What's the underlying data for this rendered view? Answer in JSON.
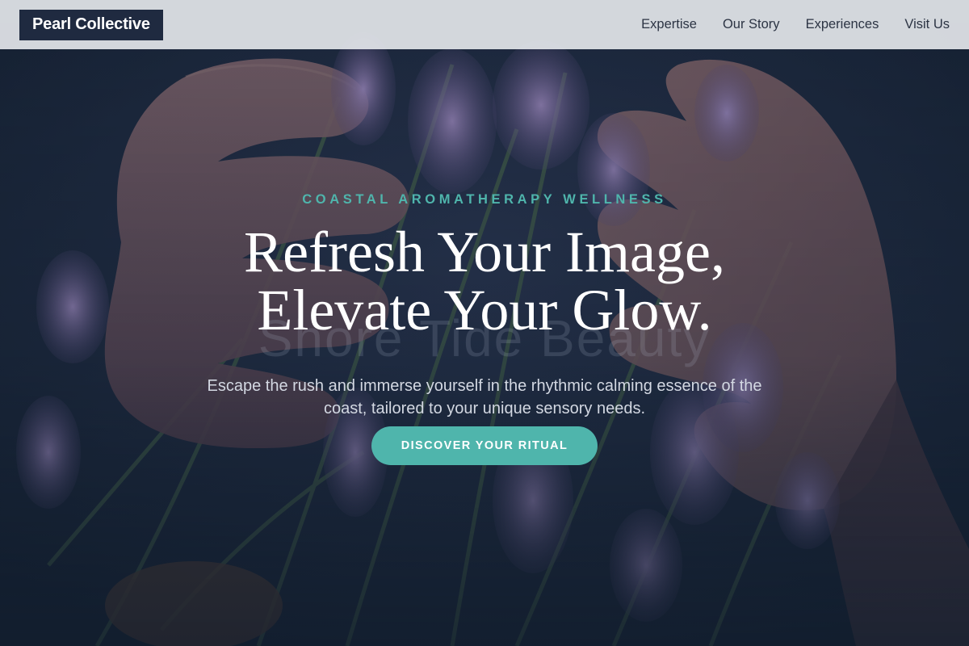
{
  "brand": {
    "name": "Pearl Collective"
  },
  "nav": {
    "items": [
      {
        "label": "Expertise"
      },
      {
        "label": "Our Story"
      },
      {
        "label": "Experiences"
      },
      {
        "label": "Visit Us"
      }
    ]
  },
  "hero": {
    "eyebrow": "COASTAL AROMATHERAPY WELLNESS",
    "headline_line1": "Refresh Your Image,",
    "headline_line2": "Elevate Your Glow.",
    "ghost_text": "Shore Tide Beauty",
    "subtext": "Escape the rush and immerse yourself in the rhythmic calming essence of the coast, tailored to your unique sensory needs.",
    "cta_label": "DISCOVER YOUR RITUAL",
    "background_image": "hands-holding-lavender-photo"
  },
  "colors": {
    "accent": "#4fb5ac",
    "brand_bg": "#1f2a40",
    "overlay": "#142233",
    "nav_bg": "#e2e5e9"
  }
}
